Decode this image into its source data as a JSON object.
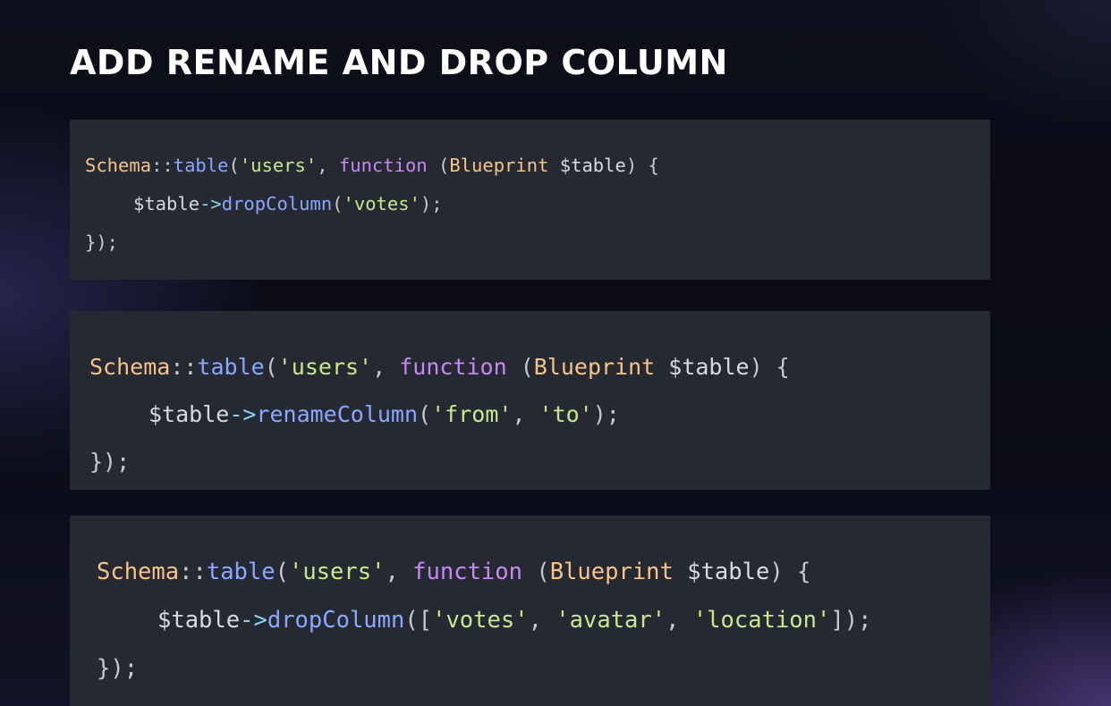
{
  "slide": {
    "title": "ADD RENAME AND DROP COLUMN"
  },
  "code_blocks": [
    {
      "line1": {
        "class": "Schema",
        "sep": "::",
        "method": "table",
        "open": "(",
        "str": "'users'",
        "comma": ", ",
        "kw": "function",
        "sp": " (",
        "type": "Blueprint",
        "var": " $table",
        "close": ") {"
      },
      "line2": {
        "var": "$table",
        "arrow": "->",
        "method": "dropColumn",
        "open": "(",
        "args": [
          "'votes'"
        ],
        "close": ");"
      },
      "line3": "});"
    },
    {
      "line1": {
        "class": "Schema",
        "sep": "::",
        "method": "table",
        "open": "(",
        "str": "'users'",
        "comma": ", ",
        "kw": "function",
        "sp": " (",
        "type": "Blueprint",
        "var": " $table",
        "close": ") {"
      },
      "line2": {
        "var": "$table",
        "arrow": "->",
        "method": "renameColumn",
        "open": "(",
        "args": [
          "'from'",
          "'to'"
        ],
        "close": ");"
      },
      "line3": "});"
    },
    {
      "line1": {
        "class": "Schema",
        "sep": "::",
        "method": "table",
        "open": "(",
        "str": "'users'",
        "comma": ", ",
        "kw": "function",
        "sp": " (",
        "type": "Blueprint",
        "var": " $table",
        "close": ") {"
      },
      "line2": {
        "var": "$table",
        "arrow": "->",
        "method": "dropColumn",
        "open": "([",
        "args": [
          "'votes'",
          "'avatar'",
          "'location'"
        ],
        "close": "]);"
      },
      "line3": "});"
    }
  ],
  "colors": {
    "background": "#0c0d1a",
    "code_bg": "#262932",
    "class": "#f4c48b",
    "method": "#8aa8ff",
    "string": "#c6e88f",
    "keyword": "#c48af0",
    "operator": "#8ad4f0"
  }
}
